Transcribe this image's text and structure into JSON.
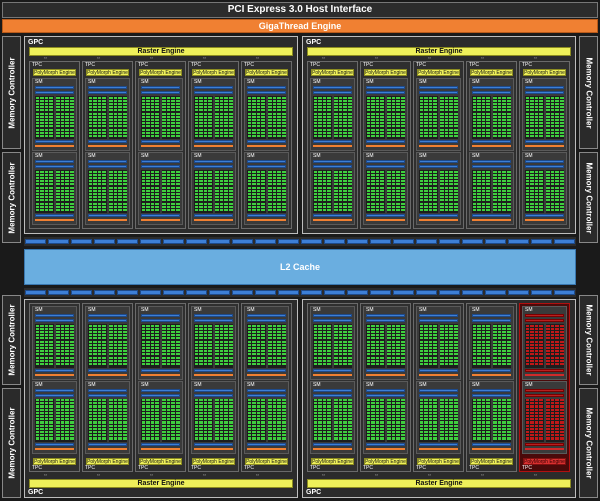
{
  "header": {
    "host_interface": "PCI Express 3.0 Host Interface",
    "thread_engine": "GigaThread Engine"
  },
  "l2_cache": "L2 Cache",
  "memory_controller_label": "Memory Controller",
  "gpc_label": "GPC",
  "raster_engine_label": "Raster Engine",
  "tpc_label": "TPC",
  "sm_label": "SM",
  "polymorph_label": "PolyMorph Engine",
  "colors": {
    "cuda_core": "#3fcf3f",
    "memory_block": "#3d7fd6",
    "giga_thread": "#f08032",
    "raster": "#eef05a",
    "l2": "#6aaee0",
    "disabled": "#c01818"
  },
  "disabled_tpc": {
    "gpc": 3,
    "tpc": 4
  }
}
